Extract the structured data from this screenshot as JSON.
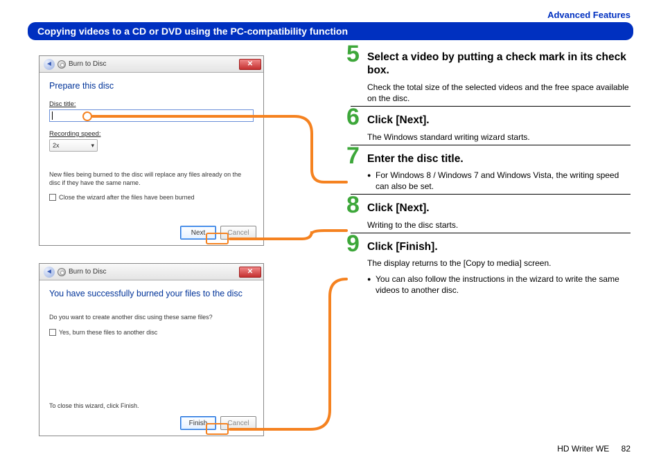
{
  "header": {
    "section": "Advanced Features"
  },
  "title": "Copying videos to a CD or DVD using the PC-compatibility function",
  "dialog1": {
    "window_title": "Burn to Disc",
    "close_label": "✕",
    "heading": "Prepare this disc",
    "disc_title_label": "Disc title:",
    "recording_speed_label": "Recording speed:",
    "speed_value": "2x",
    "note": "New files being burned to the disc will replace any files already on the disc if they have the same name.",
    "checkbox": "Close the wizard after the files have been burned",
    "next": "Next",
    "cancel": "Cancel"
  },
  "dialog2": {
    "window_title": "Burn to Disc",
    "close_label": "✕",
    "heading": "You have successfully burned your files to the disc",
    "question": "Do you want to create another disc using these same files?",
    "checkbox": "Yes, burn these files to another disc",
    "footer_note": "To close this wizard, click Finish.",
    "finish": "Finish",
    "cancel": "Cancel"
  },
  "steps": [
    {
      "num": "5",
      "title": "Select a video by putting a check mark in its check box.",
      "body": "Check the total size of the selected videos and the free space available on the disc."
    },
    {
      "num": "6",
      "title": "Click [Next].",
      "body": "The Windows standard writing wizard starts."
    },
    {
      "num": "7",
      "title": "Enter the disc title.",
      "bullets": [
        "For Windows 8 / Windows 7 and Windows Vista, the writing speed can also be set."
      ]
    },
    {
      "num": "8",
      "title": "Click [Next].",
      "body": "Writing to the disc starts."
    },
    {
      "num": "9",
      "title": "Click [Finish].",
      "body": "The display returns to the [Copy to media] screen.",
      "bullets": [
        "You can also follow the instructions in the wizard to write the same videos to another disc."
      ]
    }
  ],
  "footer": {
    "product": "HD Writer WE",
    "page": "82"
  }
}
